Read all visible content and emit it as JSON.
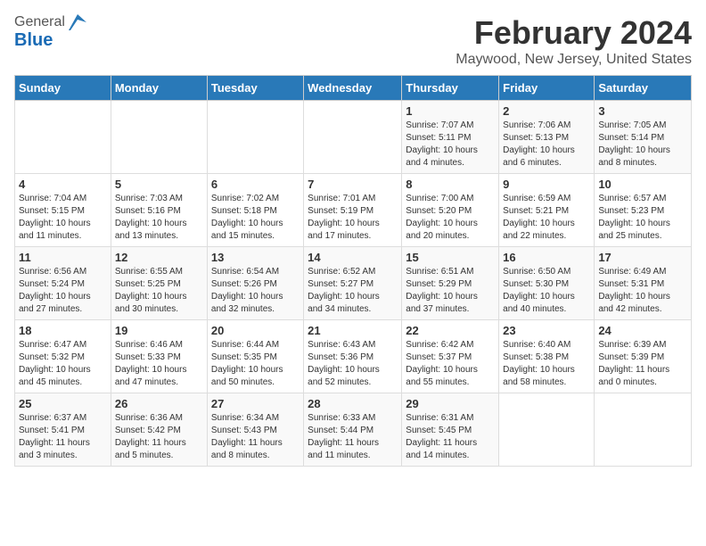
{
  "header": {
    "logo_general": "General",
    "logo_blue": "Blue",
    "title": "February 2024",
    "subtitle": "Maywood, New Jersey, United States"
  },
  "days_of_week": [
    "Sunday",
    "Monday",
    "Tuesday",
    "Wednesday",
    "Thursday",
    "Friday",
    "Saturday"
  ],
  "weeks": [
    [
      {
        "day": "",
        "info": ""
      },
      {
        "day": "",
        "info": ""
      },
      {
        "day": "",
        "info": ""
      },
      {
        "day": "",
        "info": ""
      },
      {
        "day": "1",
        "info": "Sunrise: 7:07 AM\nSunset: 5:11 PM\nDaylight: 10 hours\nand 4 minutes."
      },
      {
        "day": "2",
        "info": "Sunrise: 7:06 AM\nSunset: 5:13 PM\nDaylight: 10 hours\nand 6 minutes."
      },
      {
        "day": "3",
        "info": "Sunrise: 7:05 AM\nSunset: 5:14 PM\nDaylight: 10 hours\nand 8 minutes."
      }
    ],
    [
      {
        "day": "4",
        "info": "Sunrise: 7:04 AM\nSunset: 5:15 PM\nDaylight: 10 hours\nand 11 minutes."
      },
      {
        "day": "5",
        "info": "Sunrise: 7:03 AM\nSunset: 5:16 PM\nDaylight: 10 hours\nand 13 minutes."
      },
      {
        "day": "6",
        "info": "Sunrise: 7:02 AM\nSunset: 5:18 PM\nDaylight: 10 hours\nand 15 minutes."
      },
      {
        "day": "7",
        "info": "Sunrise: 7:01 AM\nSunset: 5:19 PM\nDaylight: 10 hours\nand 17 minutes."
      },
      {
        "day": "8",
        "info": "Sunrise: 7:00 AM\nSunset: 5:20 PM\nDaylight: 10 hours\nand 20 minutes."
      },
      {
        "day": "9",
        "info": "Sunrise: 6:59 AM\nSunset: 5:21 PM\nDaylight: 10 hours\nand 22 minutes."
      },
      {
        "day": "10",
        "info": "Sunrise: 6:57 AM\nSunset: 5:23 PM\nDaylight: 10 hours\nand 25 minutes."
      }
    ],
    [
      {
        "day": "11",
        "info": "Sunrise: 6:56 AM\nSunset: 5:24 PM\nDaylight: 10 hours\nand 27 minutes."
      },
      {
        "day": "12",
        "info": "Sunrise: 6:55 AM\nSunset: 5:25 PM\nDaylight: 10 hours\nand 30 minutes."
      },
      {
        "day": "13",
        "info": "Sunrise: 6:54 AM\nSunset: 5:26 PM\nDaylight: 10 hours\nand 32 minutes."
      },
      {
        "day": "14",
        "info": "Sunrise: 6:52 AM\nSunset: 5:27 PM\nDaylight: 10 hours\nand 34 minutes."
      },
      {
        "day": "15",
        "info": "Sunrise: 6:51 AM\nSunset: 5:29 PM\nDaylight: 10 hours\nand 37 minutes."
      },
      {
        "day": "16",
        "info": "Sunrise: 6:50 AM\nSunset: 5:30 PM\nDaylight: 10 hours\nand 40 minutes."
      },
      {
        "day": "17",
        "info": "Sunrise: 6:49 AM\nSunset: 5:31 PM\nDaylight: 10 hours\nand 42 minutes."
      }
    ],
    [
      {
        "day": "18",
        "info": "Sunrise: 6:47 AM\nSunset: 5:32 PM\nDaylight: 10 hours\nand 45 minutes."
      },
      {
        "day": "19",
        "info": "Sunrise: 6:46 AM\nSunset: 5:33 PM\nDaylight: 10 hours\nand 47 minutes."
      },
      {
        "day": "20",
        "info": "Sunrise: 6:44 AM\nSunset: 5:35 PM\nDaylight: 10 hours\nand 50 minutes."
      },
      {
        "day": "21",
        "info": "Sunrise: 6:43 AM\nSunset: 5:36 PM\nDaylight: 10 hours\nand 52 minutes."
      },
      {
        "day": "22",
        "info": "Sunrise: 6:42 AM\nSunset: 5:37 PM\nDaylight: 10 hours\nand 55 minutes."
      },
      {
        "day": "23",
        "info": "Sunrise: 6:40 AM\nSunset: 5:38 PM\nDaylight: 10 hours\nand 58 minutes."
      },
      {
        "day": "24",
        "info": "Sunrise: 6:39 AM\nSunset: 5:39 PM\nDaylight: 11 hours\nand 0 minutes."
      }
    ],
    [
      {
        "day": "25",
        "info": "Sunrise: 6:37 AM\nSunset: 5:41 PM\nDaylight: 11 hours\nand 3 minutes."
      },
      {
        "day": "26",
        "info": "Sunrise: 6:36 AM\nSunset: 5:42 PM\nDaylight: 11 hours\nand 5 minutes."
      },
      {
        "day": "27",
        "info": "Sunrise: 6:34 AM\nSunset: 5:43 PM\nDaylight: 11 hours\nand 8 minutes."
      },
      {
        "day": "28",
        "info": "Sunrise: 6:33 AM\nSunset: 5:44 PM\nDaylight: 11 hours\nand 11 minutes."
      },
      {
        "day": "29",
        "info": "Sunrise: 6:31 AM\nSunset: 5:45 PM\nDaylight: 11 hours\nand 14 minutes."
      },
      {
        "day": "",
        "info": ""
      },
      {
        "day": "",
        "info": ""
      }
    ]
  ]
}
